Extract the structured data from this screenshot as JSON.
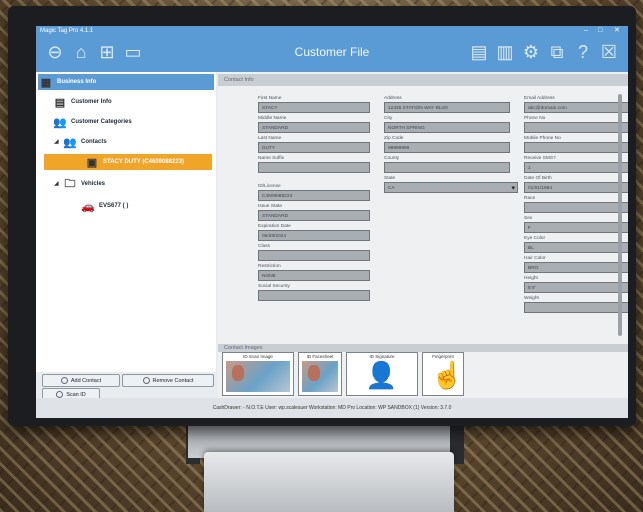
{
  "window": {
    "title": "Magic Tag Pro 4.1.1",
    "min": "–",
    "max": "□",
    "close": "✕"
  },
  "toolbar": {
    "title": "Customer File",
    "left_icons": [
      "back-icon",
      "home-icon",
      "add-icon",
      "save-icon"
    ],
    "right_icons": [
      "keyboard-icon",
      "barcode-icon",
      "settings-icon",
      "export-icon",
      "help-icon",
      "close-icon"
    ]
  },
  "tree": {
    "business_info": "Business Info",
    "customer_info": "Customer Info",
    "customer_categories": "Customer Categories",
    "contacts": "Contacts",
    "contact_selected": "STACY DUTY (C4609088223)",
    "vehicles": "Vehicles",
    "vehicle_item": "EVS677 ( )"
  },
  "buttons": {
    "add_contact": "Add Contact",
    "remove_contact": "Remove Contact",
    "scan_id": "Scan ID"
  },
  "section": {
    "contact_info": "Contact Info",
    "contact_images": "Contact Images"
  },
  "form": {
    "col1": [
      {
        "label": "First Name",
        "value": "STACY"
      },
      {
        "label": "Middle Name",
        "value": "STANDARD"
      },
      {
        "label": "Last Name",
        "value": "DUTY"
      },
      {
        "label": "Name Suffix",
        "value": ""
      },
      {
        "label": "ID/License",
        "value": "C4609088223"
      },
      {
        "label": "Issue State",
        "value": "STANDARD"
      },
      {
        "label": "Expiration Date",
        "value": "05/28/2024"
      },
      {
        "label": "Class",
        "value": ""
      },
      {
        "label": "Restriction",
        "value": "NONE"
      },
      {
        "label": "Social Security",
        "value": ""
      }
    ],
    "col2": [
      {
        "label": "Address",
        "value": "12345 STATION WAY BLVD"
      },
      {
        "label": "City",
        "value": "NORTH SPRING"
      },
      {
        "label": "Zip Code",
        "value": "99999999"
      },
      {
        "label": "County",
        "value": ""
      },
      {
        "label": "State",
        "value": "CA"
      }
    ],
    "col3": [
      {
        "label": "Email Address",
        "value": "abc@domain.com"
      },
      {
        "label": "Phone No",
        "value": ""
      },
      {
        "label": "Mobile Phone No",
        "value": ""
      },
      {
        "label": "Receive SMS?",
        "value": "1"
      },
      {
        "label": "Date Of Birth",
        "value": "01/01/1984"
      },
      {
        "label": "Race",
        "value": ""
      },
      {
        "label": "Sex",
        "value": "F"
      },
      {
        "label": "Eye Color",
        "value": "BL"
      },
      {
        "label": "Hair Color",
        "value": "BRO"
      },
      {
        "label": "Height",
        "value": "5'4\""
      },
      {
        "label": "Weight",
        "value": ""
      }
    ]
  },
  "images": [
    {
      "caption": "ID Scan Image"
    },
    {
      "caption": "ID Facesheet"
    },
    {
      "caption": "ID Signature"
    },
    {
      "caption": "Fingerprint"
    }
  ],
  "footer": "CashDrawer: - N.O.T.E   User: wp.scalesuer   Workstation: MD Pro   Location: WP SANDBOX (1)   Version: 3.7.0",
  "colors": {
    "accent": "#5b9bd5",
    "selection": "#f0a428"
  }
}
